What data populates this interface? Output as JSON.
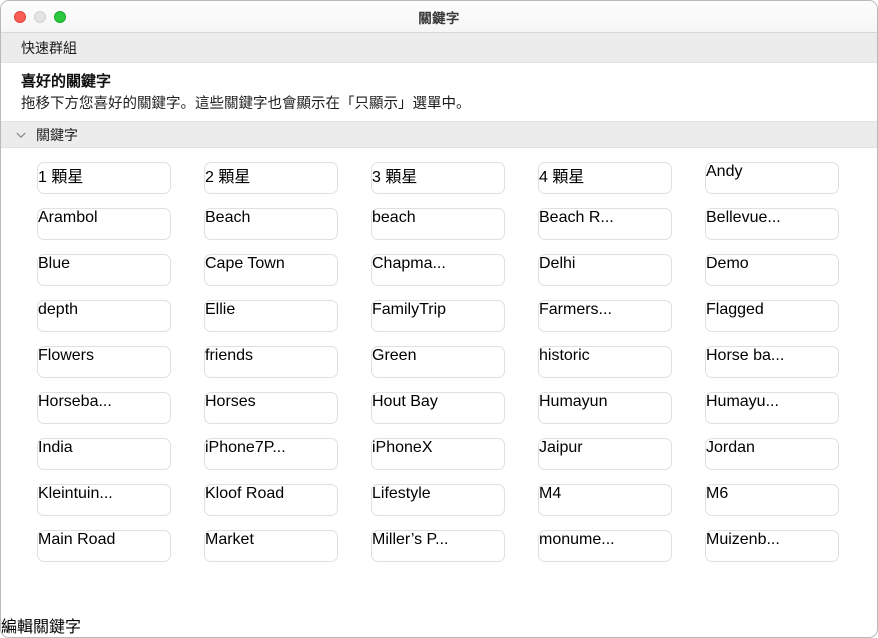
{
  "window": {
    "title": "關鍵字",
    "traffic_lights": [
      {
        "name": "close",
        "color": "#fc5d57"
      },
      {
        "name": "minimize",
        "color": "#e3e3e3"
      },
      {
        "name": "zoom",
        "color": "#2cc840"
      }
    ]
  },
  "quick_group": {
    "label": "快速群組"
  },
  "favorites": {
    "title": "喜好的關鍵字",
    "description": "拖移下方您喜好的關鍵字。這些關鍵字也會顯示在「只顯示」選單中。"
  },
  "keywords_section": {
    "label": "關鍵字",
    "disclosure_icon": "chevron-down-icon",
    "expanded": true
  },
  "keyword_grid": {
    "columns": 5,
    "items": [
      "1 顆星",
      "2 顆星",
      "3 顆星",
      "4 顆星",
      "Andy",
      "Arambol",
      "Beach",
      "beach",
      "Beach R...",
      "Bellevue...",
      "Blue",
      "Cape Town",
      "Chapma...",
      "Delhi",
      "Demo",
      "depth",
      "Ellie",
      "FamilyTrip",
      "Farmers...",
      "Flagged",
      "Flowers",
      "friends",
      "Green",
      "historic",
      "Horse ba...",
      "Horseba...",
      "Horses",
      "Hout Bay",
      "Humayun",
      "Humayu...",
      "India",
      "iPhone7P...",
      "iPhoneX",
      "Jaipur",
      "Jordan",
      "Kleintuin...",
      "Kloof Road",
      "Lifestyle",
      "M4",
      "M6",
      "Main Road",
      "Market",
      "Miller’s P...",
      "monume...",
      "Muizenb..."
    ]
  },
  "footer": {
    "edit_keywords_label": "編輯關鍵字"
  },
  "colors": {
    "window_background": "#ffffff",
    "header_strip": "#ececec",
    "footer_background": "#f2f2f2",
    "chip_border": "#e0e0e0",
    "text_primary": "#16181a"
  }
}
